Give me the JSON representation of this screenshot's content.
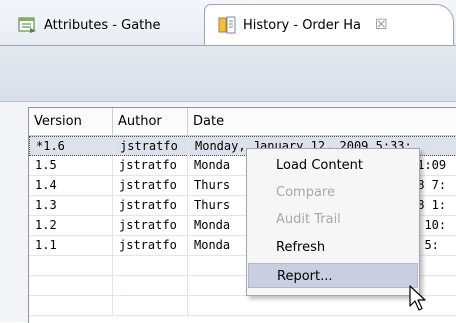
{
  "tabs": [
    {
      "label": "Attributes - Gathe",
      "icon": "attributes-icon",
      "active": false
    },
    {
      "label": "History - Order Ha",
      "icon": "history-icon",
      "active": true,
      "close_glyph": "☒"
    }
  ],
  "table": {
    "columns": [
      "Version",
      "Author",
      "Date"
    ],
    "rows": [
      {
        "version": "*1.6",
        "author": "jstratfo",
        "date": "Monday, January 12, 2009 5:33:",
        "selected": true
      },
      {
        "version": "1.5",
        "author": "jstratfo",
        "date": "Monda",
        "date_tail": "11:09"
      },
      {
        "version": "1.4",
        "author": "jstratfo",
        "date": "Thurs",
        "date_tail": "08 7:"
      },
      {
        "version": "1.3",
        "author": "jstratfo",
        "date": "Thurs",
        "date_tail": "08 1:"
      },
      {
        "version": "1.2",
        "author": "jstratfo",
        "date": "Monda",
        "date_tail": "3 10:"
      },
      {
        "version": "1.1",
        "author": "jstratfo",
        "date": "Monda",
        "date_tail": "8 5:"
      }
    ]
  },
  "context_menu": {
    "items": [
      {
        "label": "Load Content",
        "enabled": true
      },
      {
        "label": "Compare",
        "enabled": false
      },
      {
        "label": "Audit Trail",
        "enabled": false
      },
      {
        "label": "Refresh",
        "enabled": true
      },
      {
        "label": "Report...",
        "enabled": true,
        "highlighted": true
      }
    ]
  },
  "colors": {
    "selection": "#dde2ea",
    "menu_highlight": "#c9cfe0",
    "disabled_text": "#a8a8a8"
  }
}
